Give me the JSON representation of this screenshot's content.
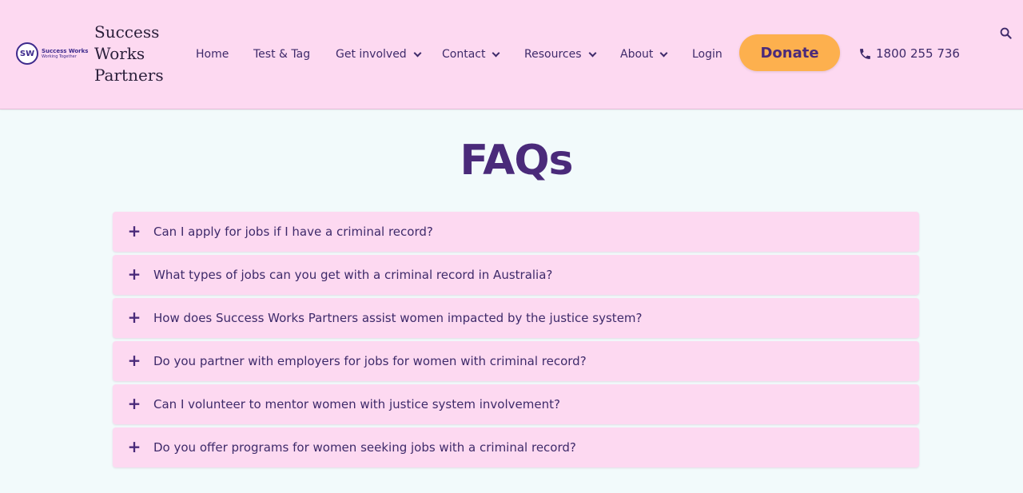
{
  "brand": {
    "logo_initials": "SW",
    "logo_line1": "Success Works",
    "logo_line2": "Working Together",
    "name_lines": [
      "Success",
      "Works",
      "Partners"
    ]
  },
  "nav": {
    "items": [
      {
        "label": "Home",
        "has_dropdown": false
      },
      {
        "label": "Test & Tag",
        "has_dropdown": false
      },
      {
        "label": "Get involved",
        "has_dropdown": true
      },
      {
        "label": "Contact",
        "has_dropdown": true
      },
      {
        "label": "Resources",
        "has_dropdown": true
      },
      {
        "label": "About",
        "has_dropdown": true
      },
      {
        "label": "Login",
        "has_dropdown": false
      }
    ],
    "donate_label": "Donate",
    "phone": "1800 255 736"
  },
  "icons": {
    "phone": "phone-icon",
    "search": "search-icon",
    "expand": "plus-icon",
    "dropdown": "chevron-down-icon"
  },
  "colors": {
    "header_bg": "#fdd9f1",
    "page_bg": "#f2fafb",
    "accent_text": "#4a2a7a",
    "donate_bg": "#fdb04e"
  },
  "main": {
    "title": "FAQs",
    "faqs": [
      {
        "question": "Can I apply for jobs if I have a criminal record?"
      },
      {
        "question": "What types of jobs can you get with a criminal record in Australia?"
      },
      {
        "question": "How does Success Works Partners assist women impacted by the justice system?"
      },
      {
        "question": "Do you partner with employers for jobs for women with criminal record?"
      },
      {
        "question": "Can I volunteer to mentor women with justice system involvement?"
      },
      {
        "question": "Do you offer programs for women seeking jobs with a criminal record?"
      }
    ],
    "expand_symbol": "+"
  }
}
